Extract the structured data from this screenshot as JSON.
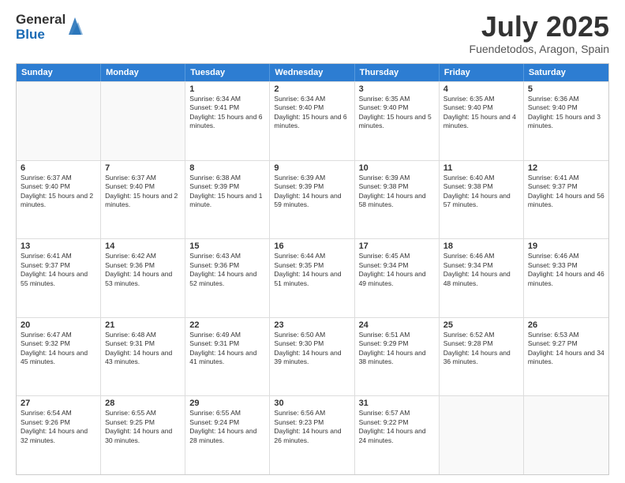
{
  "logo": {
    "general": "General",
    "blue": "Blue"
  },
  "title": {
    "month": "July 2025",
    "location": "Fuendetodos, Aragon, Spain"
  },
  "header_days": [
    "Sunday",
    "Monday",
    "Tuesday",
    "Wednesday",
    "Thursday",
    "Friday",
    "Saturday"
  ],
  "weeks": [
    [
      {
        "day": "",
        "sunrise": "",
        "sunset": "",
        "daylight": "",
        "empty": true
      },
      {
        "day": "",
        "sunrise": "",
        "sunset": "",
        "daylight": "",
        "empty": true
      },
      {
        "day": "1",
        "sunrise": "Sunrise: 6:34 AM",
        "sunset": "Sunset: 9:41 PM",
        "daylight": "Daylight: 15 hours and 6 minutes.",
        "empty": false
      },
      {
        "day": "2",
        "sunrise": "Sunrise: 6:34 AM",
        "sunset": "Sunset: 9:40 PM",
        "daylight": "Daylight: 15 hours and 6 minutes.",
        "empty": false
      },
      {
        "day": "3",
        "sunrise": "Sunrise: 6:35 AM",
        "sunset": "Sunset: 9:40 PM",
        "daylight": "Daylight: 15 hours and 5 minutes.",
        "empty": false
      },
      {
        "day": "4",
        "sunrise": "Sunrise: 6:35 AM",
        "sunset": "Sunset: 9:40 PM",
        "daylight": "Daylight: 15 hours and 4 minutes.",
        "empty": false
      },
      {
        "day": "5",
        "sunrise": "Sunrise: 6:36 AM",
        "sunset": "Sunset: 9:40 PM",
        "daylight": "Daylight: 15 hours and 3 minutes.",
        "empty": false
      }
    ],
    [
      {
        "day": "6",
        "sunrise": "Sunrise: 6:37 AM",
        "sunset": "Sunset: 9:40 PM",
        "daylight": "Daylight: 15 hours and 2 minutes.",
        "empty": false
      },
      {
        "day": "7",
        "sunrise": "Sunrise: 6:37 AM",
        "sunset": "Sunset: 9:40 PM",
        "daylight": "Daylight: 15 hours and 2 minutes.",
        "empty": false
      },
      {
        "day": "8",
        "sunrise": "Sunrise: 6:38 AM",
        "sunset": "Sunset: 9:39 PM",
        "daylight": "Daylight: 15 hours and 1 minute.",
        "empty": false
      },
      {
        "day": "9",
        "sunrise": "Sunrise: 6:39 AM",
        "sunset": "Sunset: 9:39 PM",
        "daylight": "Daylight: 14 hours and 59 minutes.",
        "empty": false
      },
      {
        "day": "10",
        "sunrise": "Sunrise: 6:39 AM",
        "sunset": "Sunset: 9:38 PM",
        "daylight": "Daylight: 14 hours and 58 minutes.",
        "empty": false
      },
      {
        "day": "11",
        "sunrise": "Sunrise: 6:40 AM",
        "sunset": "Sunset: 9:38 PM",
        "daylight": "Daylight: 14 hours and 57 minutes.",
        "empty": false
      },
      {
        "day": "12",
        "sunrise": "Sunrise: 6:41 AM",
        "sunset": "Sunset: 9:37 PM",
        "daylight": "Daylight: 14 hours and 56 minutes.",
        "empty": false
      }
    ],
    [
      {
        "day": "13",
        "sunrise": "Sunrise: 6:41 AM",
        "sunset": "Sunset: 9:37 PM",
        "daylight": "Daylight: 14 hours and 55 minutes.",
        "empty": false
      },
      {
        "day": "14",
        "sunrise": "Sunrise: 6:42 AM",
        "sunset": "Sunset: 9:36 PM",
        "daylight": "Daylight: 14 hours and 53 minutes.",
        "empty": false
      },
      {
        "day": "15",
        "sunrise": "Sunrise: 6:43 AM",
        "sunset": "Sunset: 9:36 PM",
        "daylight": "Daylight: 14 hours and 52 minutes.",
        "empty": false
      },
      {
        "day": "16",
        "sunrise": "Sunrise: 6:44 AM",
        "sunset": "Sunset: 9:35 PM",
        "daylight": "Daylight: 14 hours and 51 minutes.",
        "empty": false
      },
      {
        "day": "17",
        "sunrise": "Sunrise: 6:45 AM",
        "sunset": "Sunset: 9:34 PM",
        "daylight": "Daylight: 14 hours and 49 minutes.",
        "empty": false
      },
      {
        "day": "18",
        "sunrise": "Sunrise: 6:46 AM",
        "sunset": "Sunset: 9:34 PM",
        "daylight": "Daylight: 14 hours and 48 minutes.",
        "empty": false
      },
      {
        "day": "19",
        "sunrise": "Sunrise: 6:46 AM",
        "sunset": "Sunset: 9:33 PM",
        "daylight": "Daylight: 14 hours and 46 minutes.",
        "empty": false
      }
    ],
    [
      {
        "day": "20",
        "sunrise": "Sunrise: 6:47 AM",
        "sunset": "Sunset: 9:32 PM",
        "daylight": "Daylight: 14 hours and 45 minutes.",
        "empty": false
      },
      {
        "day": "21",
        "sunrise": "Sunrise: 6:48 AM",
        "sunset": "Sunset: 9:31 PM",
        "daylight": "Daylight: 14 hours and 43 minutes.",
        "empty": false
      },
      {
        "day": "22",
        "sunrise": "Sunrise: 6:49 AM",
        "sunset": "Sunset: 9:31 PM",
        "daylight": "Daylight: 14 hours and 41 minutes.",
        "empty": false
      },
      {
        "day": "23",
        "sunrise": "Sunrise: 6:50 AM",
        "sunset": "Sunset: 9:30 PM",
        "daylight": "Daylight: 14 hours and 39 minutes.",
        "empty": false
      },
      {
        "day": "24",
        "sunrise": "Sunrise: 6:51 AM",
        "sunset": "Sunset: 9:29 PM",
        "daylight": "Daylight: 14 hours and 38 minutes.",
        "empty": false
      },
      {
        "day": "25",
        "sunrise": "Sunrise: 6:52 AM",
        "sunset": "Sunset: 9:28 PM",
        "daylight": "Daylight: 14 hours and 36 minutes.",
        "empty": false
      },
      {
        "day": "26",
        "sunrise": "Sunrise: 6:53 AM",
        "sunset": "Sunset: 9:27 PM",
        "daylight": "Daylight: 14 hours and 34 minutes.",
        "empty": false
      }
    ],
    [
      {
        "day": "27",
        "sunrise": "Sunrise: 6:54 AM",
        "sunset": "Sunset: 9:26 PM",
        "daylight": "Daylight: 14 hours and 32 minutes.",
        "empty": false
      },
      {
        "day": "28",
        "sunrise": "Sunrise: 6:55 AM",
        "sunset": "Sunset: 9:25 PM",
        "daylight": "Daylight: 14 hours and 30 minutes.",
        "empty": false
      },
      {
        "day": "29",
        "sunrise": "Sunrise: 6:55 AM",
        "sunset": "Sunset: 9:24 PM",
        "daylight": "Daylight: 14 hours and 28 minutes.",
        "empty": false
      },
      {
        "day": "30",
        "sunrise": "Sunrise: 6:56 AM",
        "sunset": "Sunset: 9:23 PM",
        "daylight": "Daylight: 14 hours and 26 minutes.",
        "empty": false
      },
      {
        "day": "31",
        "sunrise": "Sunrise: 6:57 AM",
        "sunset": "Sunset: 9:22 PM",
        "daylight": "Daylight: 14 hours and 24 minutes.",
        "empty": false
      },
      {
        "day": "",
        "sunrise": "",
        "sunset": "",
        "daylight": "",
        "empty": true
      },
      {
        "day": "",
        "sunrise": "",
        "sunset": "",
        "daylight": "",
        "empty": true
      }
    ]
  ]
}
